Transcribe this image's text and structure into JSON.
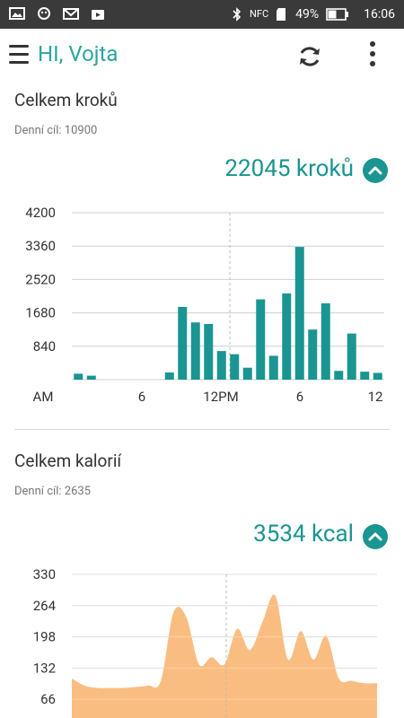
{
  "status_bar": {
    "battery_percent": "49%",
    "nfc_label": "NFC",
    "time": "16:06"
  },
  "app_bar": {
    "title": "HI, Vojta"
  },
  "steps": {
    "section_title": "Celkem kroků",
    "goal_label": "Denní cíl: 10900",
    "total": "22045 kroků"
  },
  "calories": {
    "section_title": "Celkem kalorií",
    "goal_label": "Denní cíl: 2635",
    "total": "3534 kcal"
  },
  "colors": {
    "accent": "#1a9591",
    "title": "#2aa5a0",
    "area_fill": "#f9b673"
  },
  "chart_data": [
    {
      "type": "bar",
      "title": "Celkem kroků",
      "x_tick_labels": [
        "AM",
        "6",
        "12PM",
        "6",
        "12"
      ],
      "y_tick_labels": [
        "840",
        "1680",
        "2520",
        "3360",
        "4200"
      ],
      "ylim": [
        0,
        4200
      ],
      "grid": true,
      "bar_color": "#1a9591",
      "x": [
        1,
        2,
        3,
        4,
        5,
        6,
        7,
        8,
        9,
        10,
        11,
        12,
        13,
        14,
        15,
        16,
        17,
        18,
        19,
        20,
        21,
        22,
        23,
        24
      ],
      "values": [
        150,
        100,
        0,
        0,
        0,
        0,
        0,
        180,
        1830,
        1440,
        1400,
        720,
        640,
        300,
        2020,
        600,
        2170,
        3340,
        1260,
        1920,
        220,
        1160,
        200,
        170
      ]
    },
    {
      "type": "area",
      "title": "Celkem kalorií",
      "y_tick_labels": [
        "66",
        "132",
        "198",
        "264",
        "330"
      ],
      "ylim": [
        0,
        330
      ],
      "grid": true,
      "fill_color": "#f9b673",
      "x": [
        0,
        1,
        2,
        3,
        4,
        5,
        6,
        7,
        8,
        9,
        10,
        11,
        12,
        13,
        14,
        15,
        16,
        17,
        18,
        19,
        20,
        21,
        22,
        23,
        24
      ],
      "values": [
        110,
        95,
        90,
        90,
        90,
        92,
        95,
        105,
        250,
        240,
        140,
        155,
        140,
        215,
        170,
        230,
        285,
        150,
        210,
        150,
        200,
        110,
        105,
        100,
        100
      ]
    }
  ]
}
